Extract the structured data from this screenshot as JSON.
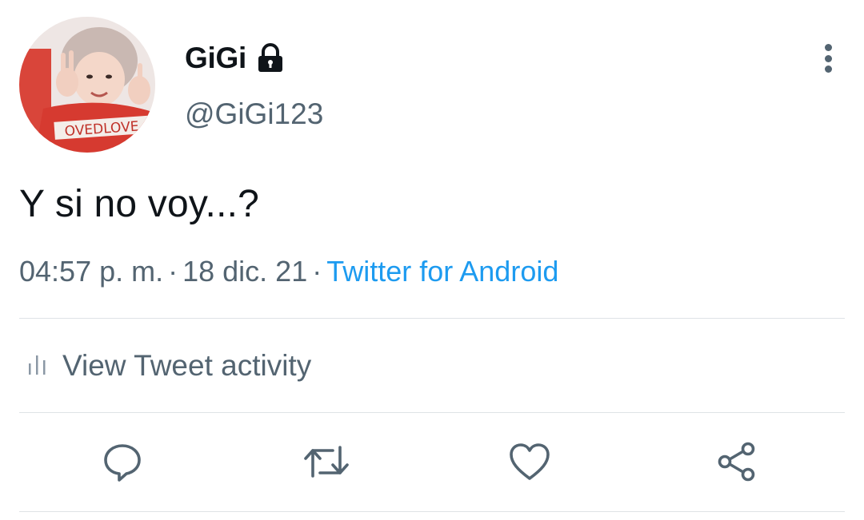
{
  "user": {
    "display_name": "GiGi",
    "handle": "@GiGi123",
    "avatar_shirt_text": "OVEDLOVE",
    "protected_icon": "lock-icon"
  },
  "tweet": {
    "text": "Y si no voy...?",
    "time": "04:57 p. m.",
    "date": "18 dic. 21",
    "separator": "·",
    "source": "Twitter for Android"
  },
  "activity": {
    "label": "View Tweet activity",
    "icon": "bar-chart-icon"
  },
  "actions": {
    "reply_icon": "reply-icon",
    "retweet_icon": "retweet-icon",
    "like_icon": "heart-icon",
    "share_icon": "share-icon",
    "more_icon": "more-vertical-icon"
  },
  "colors": {
    "primary_text": "#0f1419",
    "secondary_text": "#536471",
    "link": "#1d9bf0",
    "divider": "#dfe3e6"
  }
}
